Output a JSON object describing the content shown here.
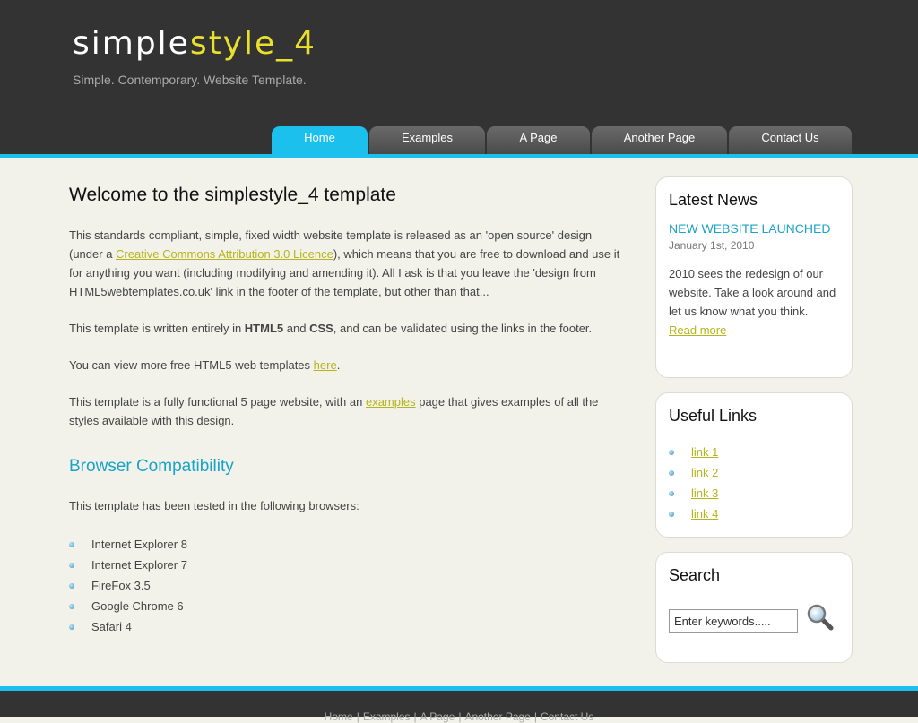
{
  "header": {
    "logo_main": "simple",
    "logo_accent": "style_4",
    "slogan": "Simple. Contemporary. Website Template."
  },
  "nav": {
    "items": [
      {
        "label": "Home",
        "active": true
      },
      {
        "label": "Examples",
        "active": false
      },
      {
        "label": "A Page",
        "active": false
      },
      {
        "label": "Another Page",
        "active": false
      },
      {
        "label": "Contact Us",
        "active": false
      }
    ]
  },
  "content": {
    "title": "Welcome to the simplestyle_4 template",
    "p1": {
      "a": "This standards compliant, simple, fixed width website template is released as an 'open source' design (under a ",
      "link": "Creative Commons Attribution 3.0 Licence",
      "b": "), which means that you are free to download and use it for anything you want (including modifying and amending it). All I ask is that you leave the 'design from HTML5webtemplates.co.uk' link in the footer of the template, but other than that..."
    },
    "p2": {
      "a": "This template is written entirely in ",
      "html5": "HTML5",
      "and": " and ",
      "css": "CSS",
      "b": ", and can be validated using the links in the footer."
    },
    "p3": {
      "a": "You can view more free HTML5 web templates ",
      "link": "here",
      "b": "."
    },
    "p4": {
      "a": "This template is a fully functional 5 page website, with an ",
      "link": "examples",
      "b": " page that gives examples of all the styles available with this design."
    },
    "browser_heading": "Browser Compatibility",
    "browser_intro": "This template has been tested in the following browsers:",
    "browsers": [
      "Internet Explorer 8",
      "Internet Explorer 7",
      "FireFox 3.5",
      "Google Chrome 6",
      "Safari 4"
    ]
  },
  "sidebar": {
    "news": {
      "heading": "Latest News",
      "title": "New Website Launched",
      "date": "January 1st, 2010",
      "text": "2010 sees the redesign of our website. Take a look around and let us know what you think.",
      "more": "Read more"
    },
    "links": {
      "heading": "Useful Links",
      "items": [
        "link 1",
        "link 2",
        "link 3",
        "link 4"
      ]
    },
    "search": {
      "heading": "Search",
      "value": "Enter keywords.....",
      "icon": "search-icon"
    }
  },
  "footer": {
    "items": [
      "Home",
      "Examples",
      "A Page",
      "Another Page",
      "Contact Us"
    ],
    "separator": "|"
  },
  "colors": {
    "header_bg": "#333333",
    "accent_cyan": "#1bc0ec",
    "logo_yellow": "#e9e02c",
    "link_olive": "#b5b51a",
    "heading_blue": "#1aa3c8",
    "page_bg": "#f2f2eb"
  }
}
